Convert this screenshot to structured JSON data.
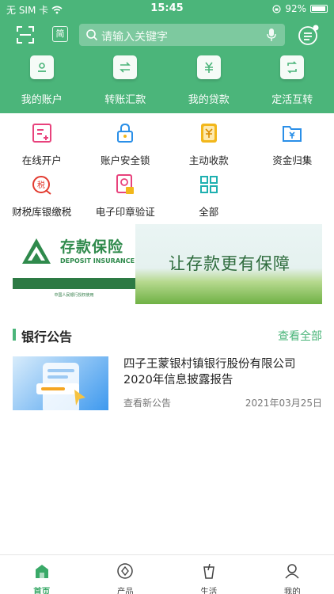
{
  "status_bar": {
    "carrier": "无 SIM 卡",
    "time": "15:45",
    "battery": "92%"
  },
  "topbar": {
    "simplified_label": "简",
    "search_placeholder": "请输入关键字"
  },
  "quick_actions": [
    {
      "label": "我的账户",
      "icon": "account-icon"
    },
    {
      "label": "转账汇款",
      "icon": "transfer-icon"
    },
    {
      "label": "我的贷款",
      "icon": "loan-icon"
    },
    {
      "label": "定活互转",
      "icon": "exchange-icon"
    }
  ],
  "services": [
    {
      "label": "在线开户",
      "icon": "online-account-icon"
    },
    {
      "label": "账户安全锁",
      "icon": "security-lock-icon"
    },
    {
      "label": "主动收款",
      "icon": "receive-payment-icon"
    },
    {
      "label": "资金归集",
      "icon": "fund-collection-icon"
    },
    {
      "label": "财税库银缴税",
      "icon": "tax-payment-icon"
    },
    {
      "label": "电子印章验证",
      "icon": "e-seal-icon"
    },
    {
      "label": "全部",
      "icon": "all-grid-icon"
    }
  ],
  "banner": {
    "title_cn": "存款保险",
    "title_en": "DEPOSIT INSURANCE",
    "slogan": "让存款更有保障",
    "footnote": "中国人民银行授权使用"
  },
  "announcements": {
    "section_title": "银行公告",
    "view_all": "查看全部",
    "items": [
      {
        "title": "四子王蒙银村镇银行股份有限公司2020年信息披露报告",
        "subtitle": "查看新公告",
        "date": "2021年03月25日"
      }
    ]
  },
  "tabs": [
    {
      "label": "首页",
      "active": true
    },
    {
      "label": "产品",
      "active": false
    },
    {
      "label": "生活",
      "active": false
    },
    {
      "label": "我的",
      "active": false
    }
  ],
  "colors": {
    "brand_green": "#4bb57a",
    "icon_pink": "#e8427c",
    "icon_blue": "#2a8fe8",
    "icon_yellow": "#f2b71b",
    "icon_red": "#e23a2f"
  }
}
